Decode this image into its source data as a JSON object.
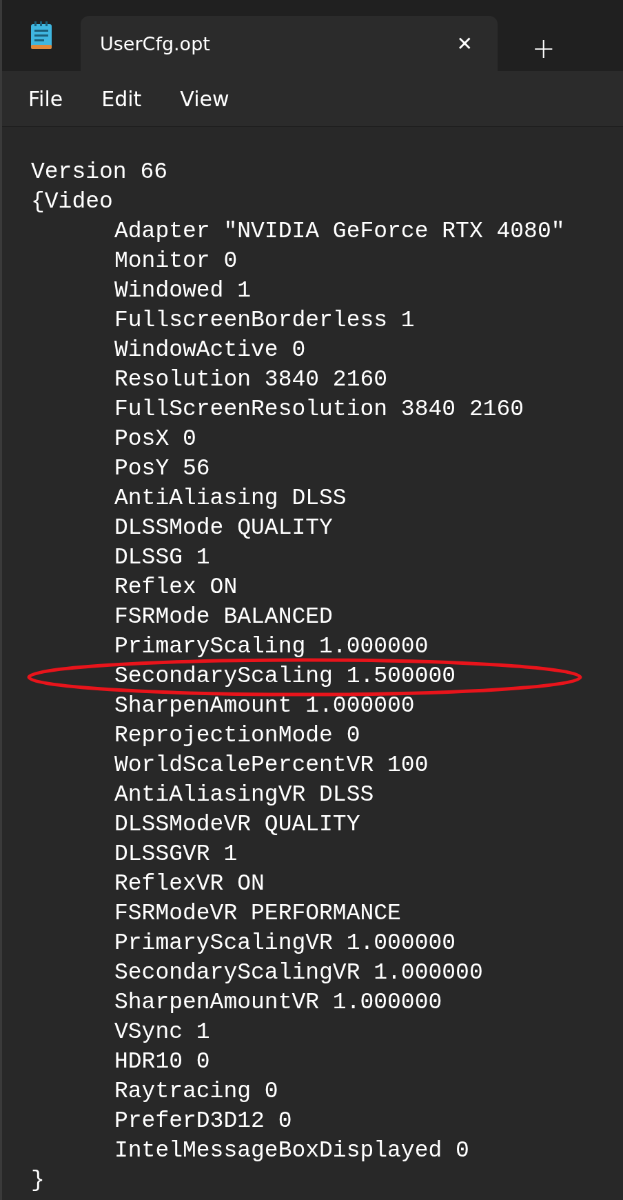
{
  "tab": {
    "title": "UserCfg.opt",
    "close": "✕",
    "new_tab": "+"
  },
  "menu": [
    "File",
    "Edit",
    "View"
  ],
  "lines": [
    {
      "text": "Version 66"
    },
    {
      "text": "{Video",
      "children": [
        {
          "text": "Adapter \"NVIDIA GeForce RTX 4080\"",
          "circled": false
        },
        {
          "text": "Monitor 0",
          "circled": false
        },
        {
          "text": "Windowed 1",
          "circled": false
        },
        {
          "text": "FullscreenBorderless 1",
          "circled": false
        },
        {
          "text": "WindowActive 0",
          "circled": false
        },
        {
          "text": "Resolution 3840 2160",
          "circled": false
        },
        {
          "text": "FullScreenResolution 3840 2160",
          "circled": false
        },
        {
          "text": "PosX 0",
          "circled": false
        },
        {
          "text": "PosY 56",
          "circled": false
        },
        {
          "text": "AntiAliasing DLSS",
          "circled": false
        },
        {
          "text": "DLSSMode QUALITY",
          "circled": false
        },
        {
          "text": "DLSSG 1",
          "circled": false
        },
        {
          "text": "Reflex ON",
          "circled": false
        },
        {
          "text": "FSRMode BALANCED",
          "circled": false
        },
        {
          "text": "PrimaryScaling 1.000000",
          "circled": false
        },
        {
          "text": "SecondaryScaling 1.500000",
          "circled": true
        },
        {
          "text": "SharpenAmount 1.000000",
          "circled": false
        },
        {
          "text": "ReprojectionMode 0",
          "circled": false
        },
        {
          "text": "WorldScalePercentVR 100",
          "circled": false
        },
        {
          "text": "AntiAliasingVR DLSS",
          "circled": false
        },
        {
          "text": "DLSSModeVR QUALITY",
          "circled": false
        },
        {
          "text": "DLSSGVR 1",
          "circled": false
        },
        {
          "text": "ReflexVR ON",
          "circled": false
        },
        {
          "text": "FSRModeVR PERFORMANCE",
          "circled": false
        },
        {
          "text": "PrimaryScalingVR 1.000000",
          "circled": false
        },
        {
          "text": "SecondaryScalingVR 1.000000",
          "circled": false
        },
        {
          "text": "SharpenAmountVR 1.000000",
          "circled": false
        },
        {
          "text": "VSync 1",
          "circled": false
        },
        {
          "text": "HDR10 0",
          "circled": false
        },
        {
          "text": "Raytracing 0",
          "circled": false
        },
        {
          "text": "PreferD3D12 0",
          "circled": false
        },
        {
          "text": "IntelMessageBoxDisplayed 0",
          "circled": false
        }
      ]
    },
    {
      "text": "}"
    }
  ]
}
